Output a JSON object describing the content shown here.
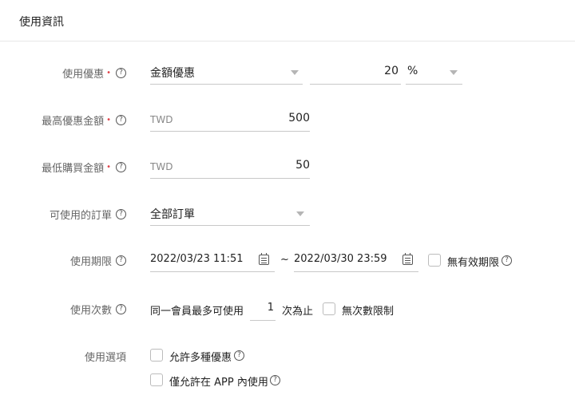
{
  "header": {
    "title": "使用資訊"
  },
  "discount": {
    "label": "使用優惠",
    "type_value": "金額優惠",
    "amount_value": "20",
    "unit_value": "%"
  },
  "max_discount": {
    "label": "最高優惠金額",
    "prefix": "TWD",
    "value": "500"
  },
  "min_purchase": {
    "label": "最低購買金額",
    "prefix": "TWD",
    "value": "50"
  },
  "orders": {
    "label": "可使用的訂單",
    "value": "全部訂單"
  },
  "period": {
    "label": "使用期限",
    "start": "2022/03/23 11:51",
    "separator": "~",
    "end": "2022/03/30 23:59",
    "no_limit_label": "無有效期限"
  },
  "usage_count": {
    "label": "使用次數",
    "prefix_text": "同一會員最多可使用",
    "value": "1",
    "suffix_text": "次為止",
    "no_limit_label": "無次數限制"
  },
  "options": {
    "label": "使用選項",
    "allow_multiple_label": "允許多種優惠",
    "app_only_label": "僅允許在 APP 內使用"
  },
  "icons": {
    "help": "question-circle-icon",
    "calendar": "calendar-icon",
    "dropdown": "caret-down-icon"
  },
  "colors": {
    "required": "#e0434a",
    "border": "#c8c8c8",
    "label": "#666666"
  }
}
